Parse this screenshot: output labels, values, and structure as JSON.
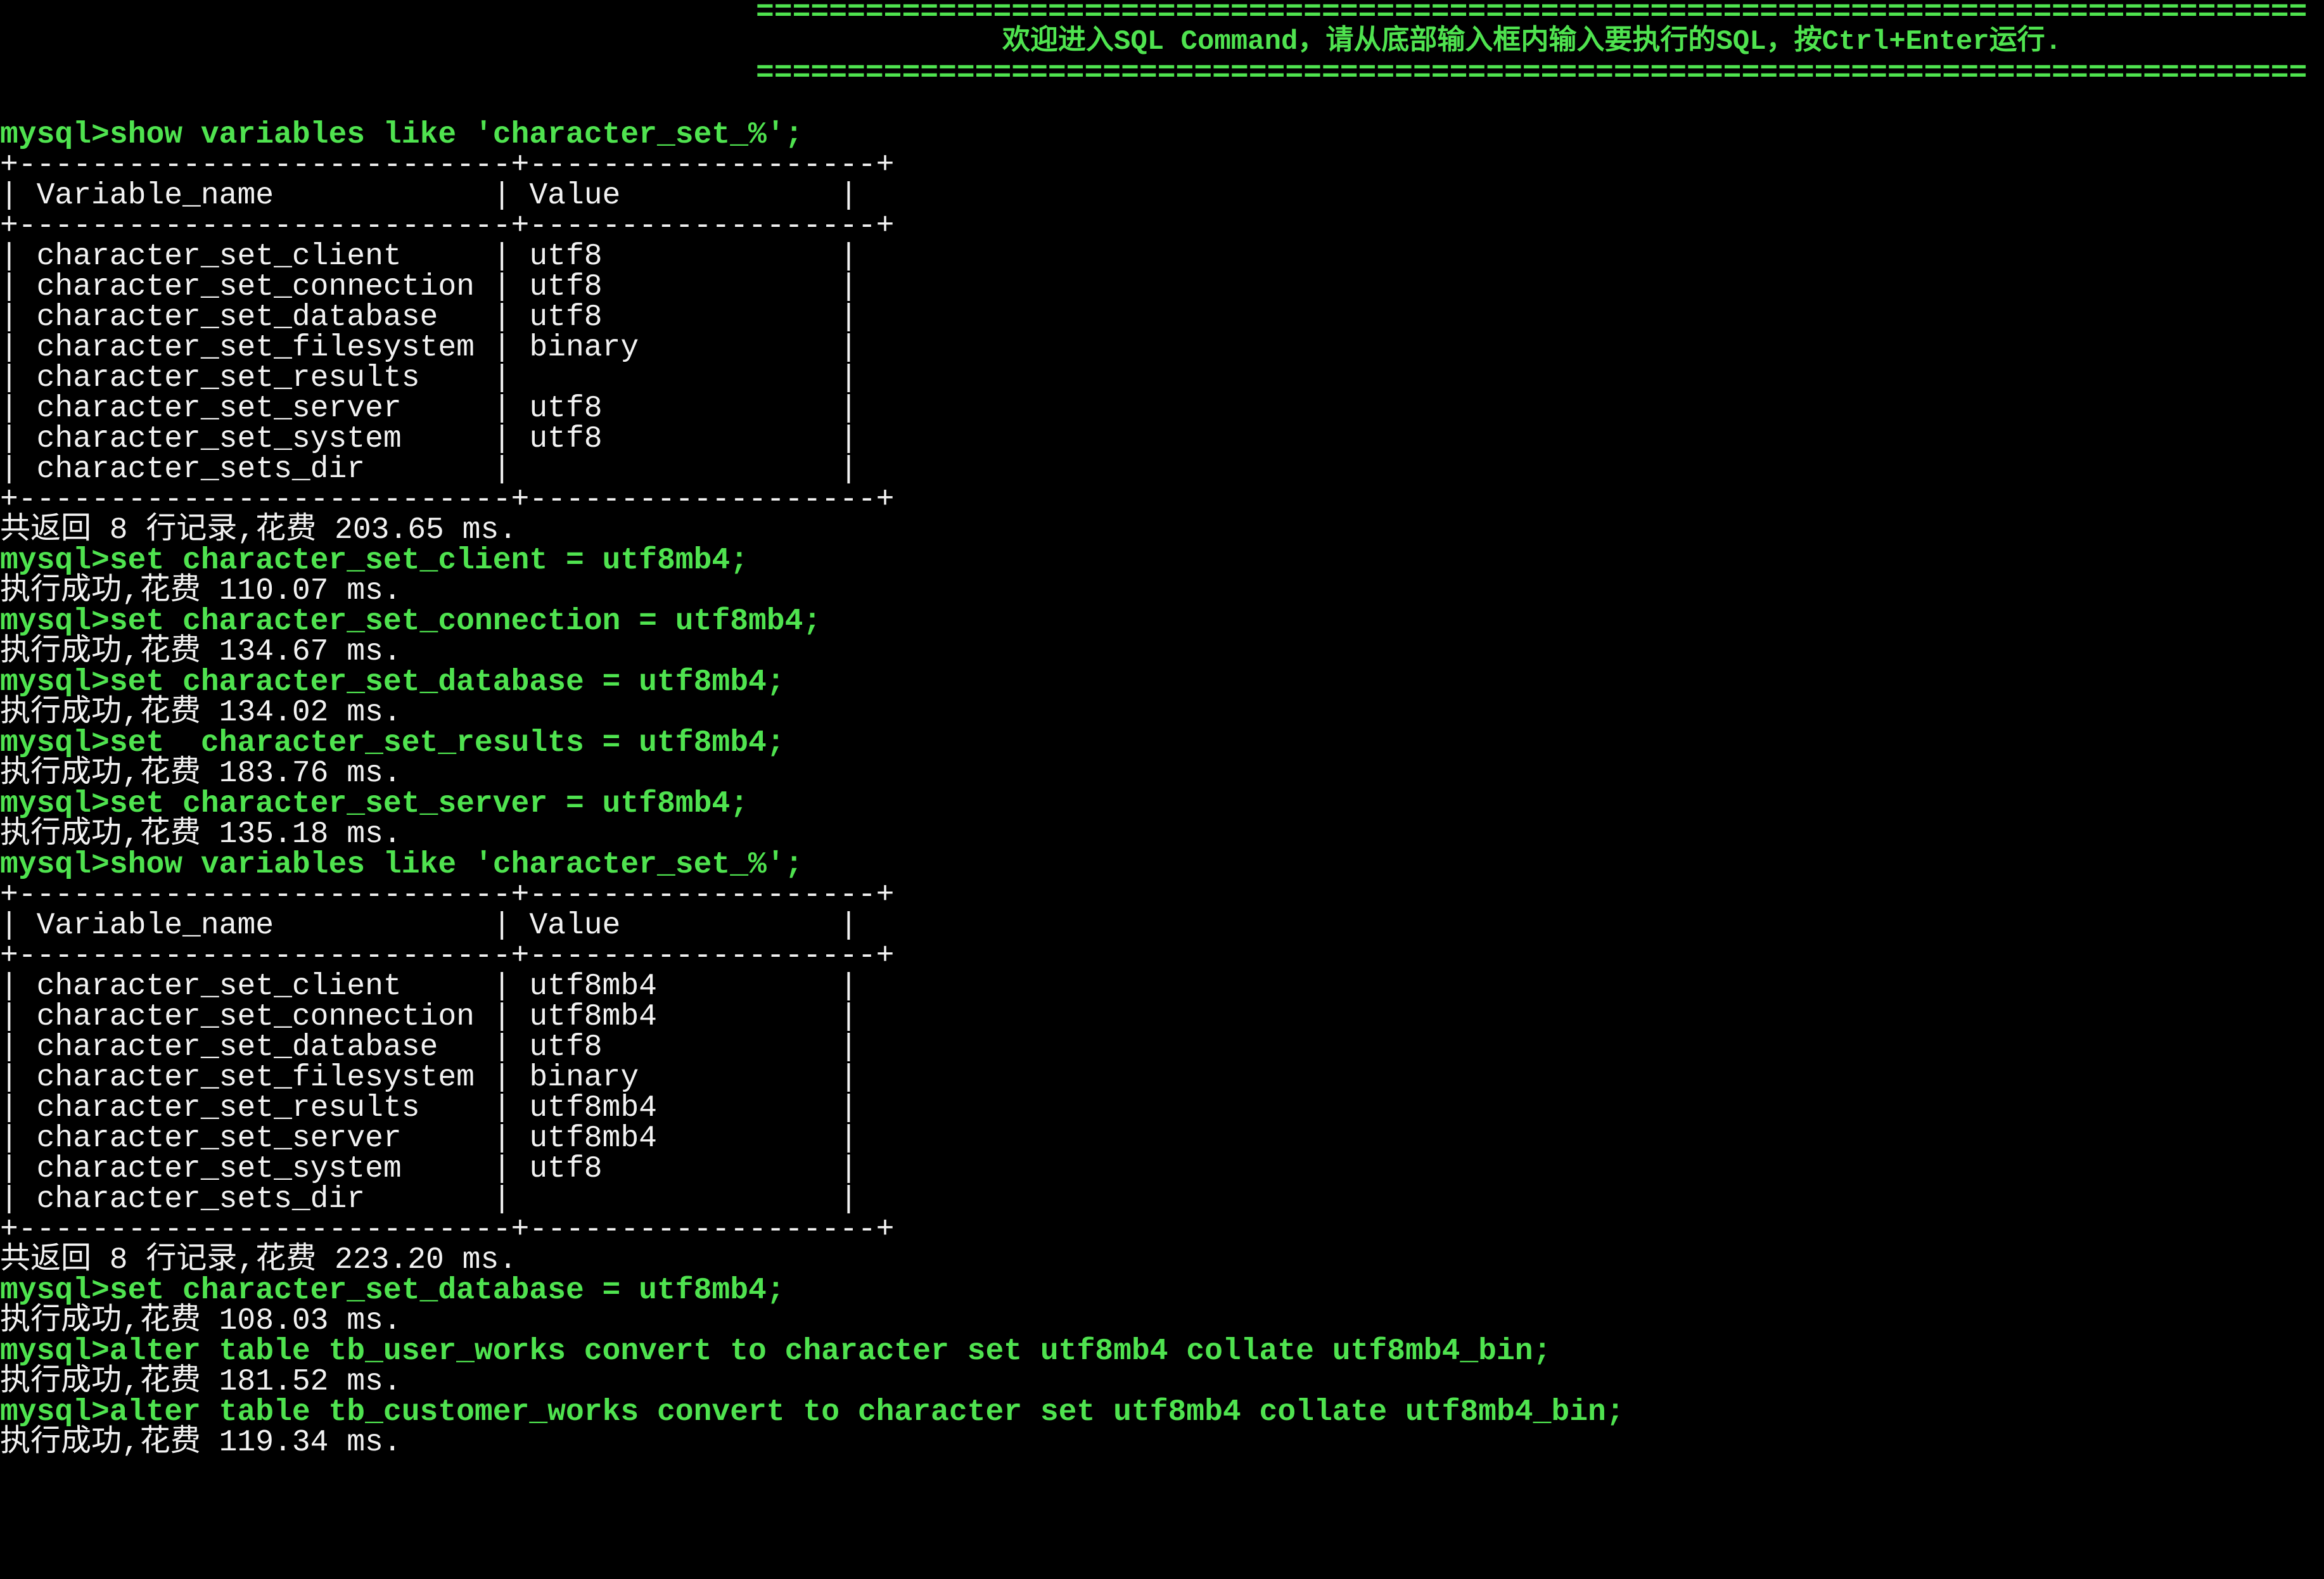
{
  "banner": {
    "rule": "=====================================================================================",
    "message": "欢迎进入SQL Command，请从底部输入框内输入要执行的SQL，按Ctrl+Enter运行."
  },
  "colors": {
    "background": "#000000",
    "command_text": "#4fe34f",
    "output_text": "#f2f2f2"
  },
  "session": {
    "prompt": "mysql>",
    "blocks": [
      {
        "command": "show variables like 'character_set_%';",
        "result_table": {
          "border": "+---------------------------+-------------------+",
          "headers": [
            "Variable_name",
            "Value"
          ],
          "rows": [
            [
              "character_set_client",
              "utf8"
            ],
            [
              "character_set_connection",
              "utf8"
            ],
            [
              "character_set_database",
              "utf8"
            ],
            [
              "character_set_filesystem",
              "binary"
            ],
            [
              "character_set_results",
              ""
            ],
            [
              "character_set_server",
              "utf8"
            ],
            [
              "character_set_system",
              "utf8"
            ],
            [
              "character_sets_dir",
              ""
            ]
          ]
        },
        "status": "共返回 8 行记录,花费 203.65 ms."
      },
      {
        "command": "set character_set_client = utf8mb4;",
        "status": "执行成功,花费 110.07 ms."
      },
      {
        "command": "set character_set_connection = utf8mb4;",
        "status": "执行成功,花费 134.67 ms."
      },
      {
        "command": "set character_set_database = utf8mb4;",
        "status": "执行成功,花费 134.02 ms."
      },
      {
        "command": "set  character_set_results = utf8mb4;",
        "status": "执行成功,花费 183.76 ms."
      },
      {
        "command": "set character_set_server = utf8mb4;",
        "status": "执行成功,花费 135.18 ms."
      },
      {
        "command": "show variables like 'character_set_%';",
        "result_table": {
          "border": "+---------------------------+-------------------+",
          "headers": [
            "Variable_name",
            "Value"
          ],
          "rows": [
            [
              "character_set_client",
              "utf8mb4"
            ],
            [
              "character_set_connection",
              "utf8mb4"
            ],
            [
              "character_set_database",
              "utf8"
            ],
            [
              "character_set_filesystem",
              "binary"
            ],
            [
              "character_set_results",
              "utf8mb4"
            ],
            [
              "character_set_server",
              "utf8mb4"
            ],
            [
              "character_set_system",
              "utf8"
            ],
            [
              "character_sets_dir",
              ""
            ]
          ]
        },
        "status": "共返回 8 行记录,花费 223.20 ms."
      },
      {
        "command": "set character_set_database = utf8mb4;",
        "status": "执行成功,花费 108.03 ms."
      },
      {
        "command": "alter table tb_user_works convert to character set utf8mb4 collate utf8mb4_bin;",
        "status": "执行成功,花费 181.52 ms."
      },
      {
        "command": "alter table tb_customer_works convert to character set utf8mb4 collate utf8mb4_bin;",
        "status": "执行成功,花费 119.34 ms."
      }
    ]
  }
}
